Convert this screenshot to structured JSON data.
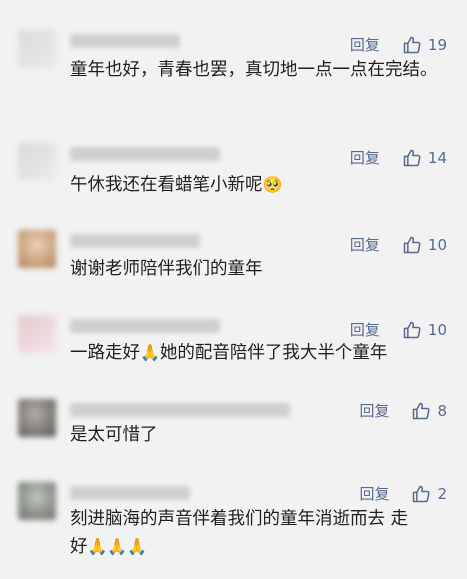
{
  "comments": [
    {
      "reply_label": "回复",
      "likes": "19",
      "text": "童年也好，青春也罢，真切地一点一点在完结。",
      "avatar_colors": [
        "#dcdcdc",
        "#e8e8e8"
      ]
    },
    {
      "reply_label": "回复",
      "likes": "14",
      "text": "午休我还在看蜡笔小新呢",
      "emoji": "🥺",
      "avatar_colors": [
        "#d8d8d8",
        "#ececec"
      ]
    },
    {
      "reply_label": "回复",
      "likes": "10",
      "text": "谢谢老师陪伴我们的童年",
      "avatar_colors": [
        "#c9a27a",
        "#e9d3bf"
      ]
    },
    {
      "reply_label": "回复",
      "likes": "10",
      "text_before": "一路走好",
      "emoji": "🙏",
      "text_after": "她的配音陪伴了我大半个童年",
      "avatar_colors": [
        "#e6c9cf",
        "#f3e4e7"
      ]
    },
    {
      "reply_label": "回复",
      "likes": "8",
      "text": "是太可惜了",
      "avatar_colors": [
        "#7d7975",
        "#b3aea8"
      ]
    },
    {
      "reply_label": "回复",
      "likes": "2",
      "text_line1": "刻进脑海的声音伴着我们的童年消逝而去 走",
      "text_line2": "好",
      "emoji": "🙏🙏🙏",
      "avatar_colors": [
        "#8a9088",
        "#c1c6c0"
      ]
    }
  ],
  "icons": {
    "like": "thumbs-up-icon"
  },
  "colors": {
    "action": "#58698f",
    "text": "#1f1f1f",
    "background": "#f2f2f2"
  }
}
